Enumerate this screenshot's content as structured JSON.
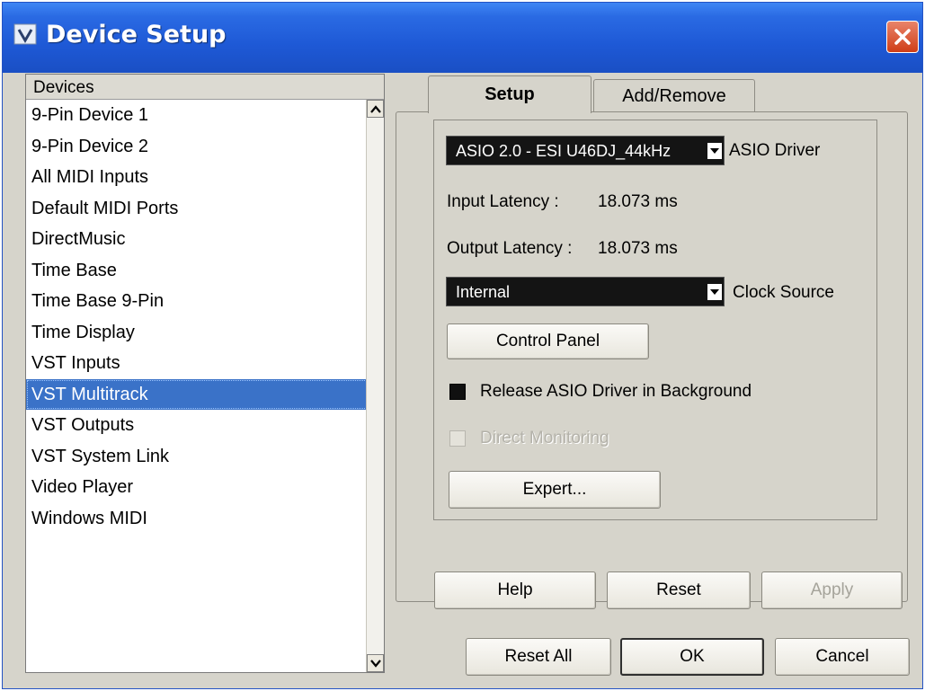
{
  "window": {
    "title": "Device Setup"
  },
  "devices": {
    "header": "Devices",
    "items": [
      {
        "label": "9-Pin Device 1"
      },
      {
        "label": "9-Pin Device 2"
      },
      {
        "label": "All MIDI Inputs"
      },
      {
        "label": "Default MIDI Ports"
      },
      {
        "label": "DirectMusic"
      },
      {
        "label": "Time Base"
      },
      {
        "label": "Time Base 9-Pin"
      },
      {
        "label": "Time Display"
      },
      {
        "label": "VST Inputs"
      },
      {
        "label": "VST Multitrack",
        "selected": true
      },
      {
        "label": "VST Outputs"
      },
      {
        "label": "VST System Link"
      },
      {
        "label": "Video Player"
      },
      {
        "label": "Windows MIDI"
      }
    ]
  },
  "tabs": {
    "setup": "Setup",
    "add_remove": "Add/Remove"
  },
  "setup": {
    "asio_driver_value": "ASIO 2.0 - ESI U46DJ_44kHz",
    "asio_driver_label": "ASIO Driver",
    "input_latency_label": "Input Latency :",
    "input_latency_value": "18.073 ms",
    "output_latency_label": "Output Latency :",
    "output_latency_value": "18.073 ms",
    "clock_source_value": "Internal",
    "clock_source_label": "Clock Source",
    "control_panel_label": "Control Panel",
    "release_driver_label": "Release ASIO Driver in Background",
    "release_driver_checked": true,
    "direct_monitoring_label": "Direct Monitoring",
    "direct_monitoring_checked": false,
    "expert_label": "Expert..."
  },
  "panel_buttons": {
    "help": "Help",
    "reset": "Reset",
    "apply": "Apply"
  },
  "dialog_buttons": {
    "reset_all": "Reset All",
    "ok": "OK",
    "cancel": "Cancel"
  },
  "colors": {
    "titlebar": "#2a6ae3",
    "selection": "#3a72c8",
    "close": "#cf3e17"
  }
}
